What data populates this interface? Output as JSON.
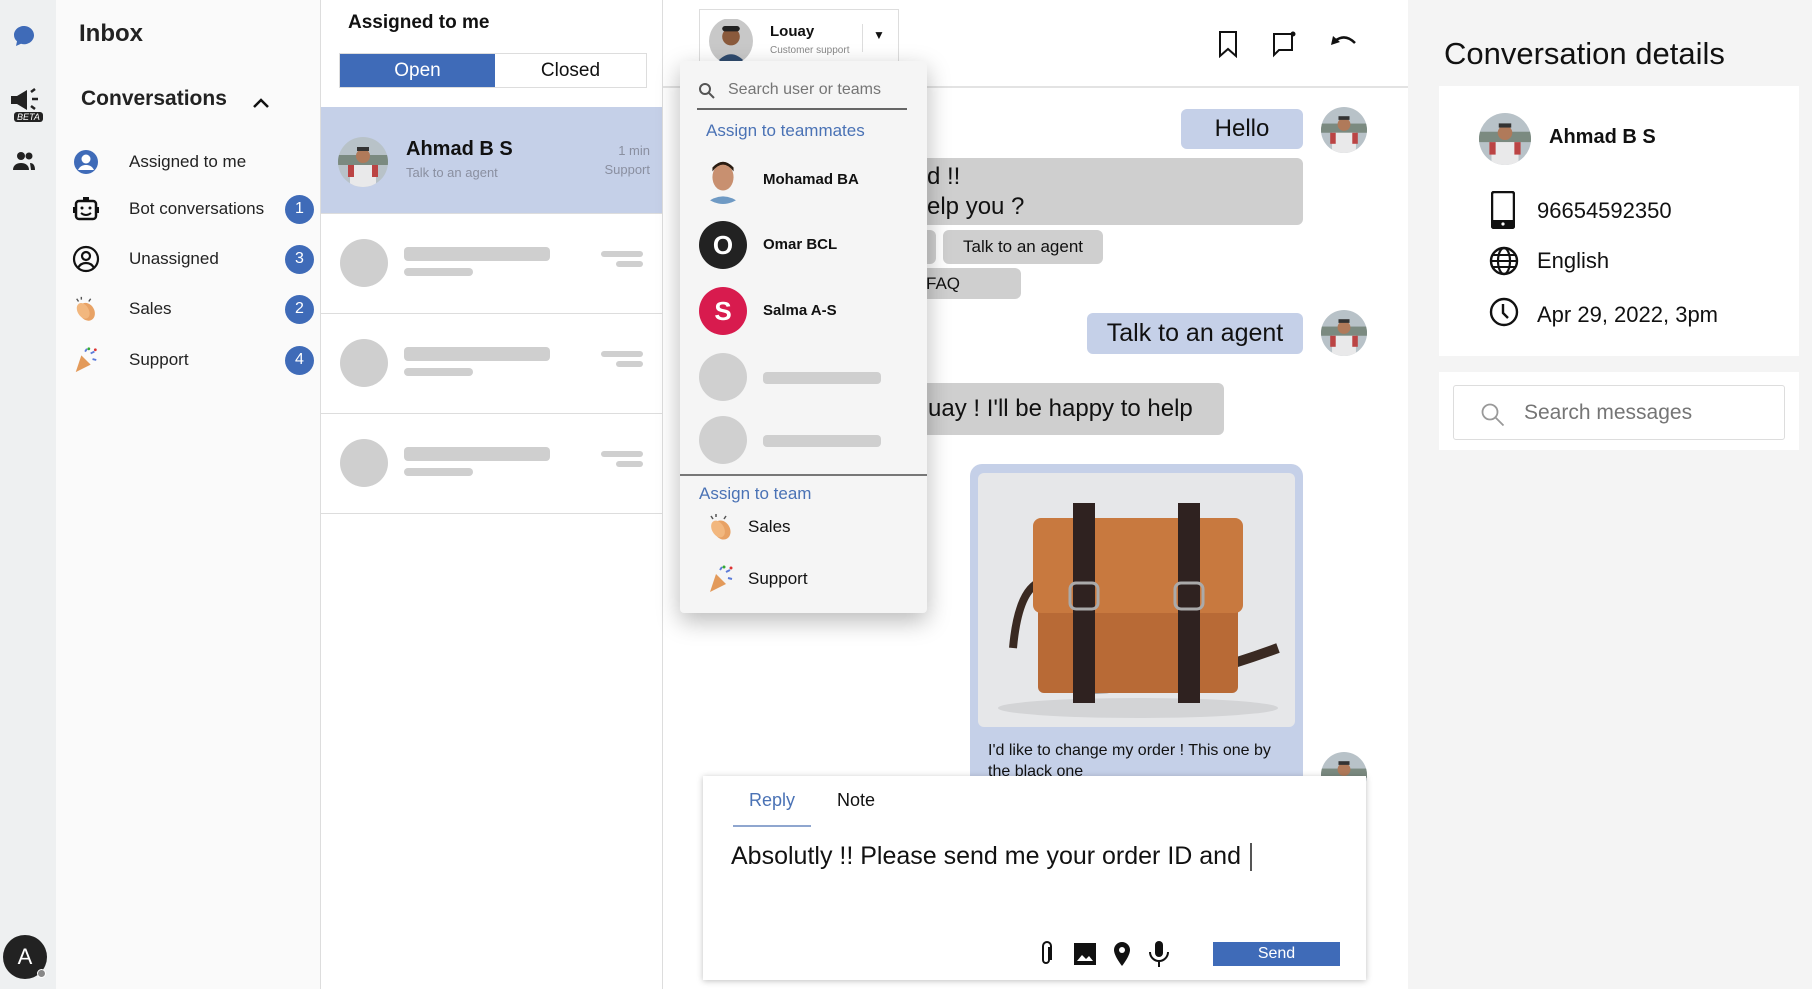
{
  "rail": {
    "icons": [
      "chat-bubble-icon",
      "megaphone-icon",
      "people-icon"
    ],
    "beta_label": "BETA",
    "user_avatar_letter": "A",
    "accent": "#3f6bb8"
  },
  "nav": {
    "title": "Inbox",
    "section": "Conversations",
    "items": [
      {
        "label": "Assigned to me",
        "icon": "user-circle-icon",
        "badge": null
      },
      {
        "label": "Bot conversations",
        "icon": "bot-icon",
        "badge": "1"
      },
      {
        "label": "Unassigned",
        "icon": "user-outline-icon",
        "badge": "3"
      },
      {
        "label": "Sales",
        "icon": "clapping-hands-icon",
        "badge": "2"
      },
      {
        "label": "Support",
        "icon": "party-popper-icon",
        "badge": "4"
      }
    ]
  },
  "list": {
    "title": "Assigned to me",
    "tabs": {
      "open": "Open",
      "closed": "Closed"
    },
    "active_tab": "Open",
    "conversation": {
      "name": "Ahmad B S",
      "preview": "Talk to an agent",
      "time": "1 min",
      "team": "Support"
    }
  },
  "header": {
    "agent_name": "Louay",
    "agent_role": "Customer support",
    "icons": [
      "bookmark-icon",
      "flag-chat-icon",
      "undo-icon"
    ]
  },
  "dropdown": {
    "search_placeholder": "Search user or teams",
    "teammates_heading": "Assign to teammates",
    "teammates": [
      {
        "name": "Mohamad BA",
        "initial": ""
      },
      {
        "name": "Omar BCL",
        "initial": "O",
        "color": "#222222"
      },
      {
        "name": "Salma A-S",
        "initial": "S",
        "color": "#d81b4e"
      }
    ],
    "team_heading": "Assign to team",
    "teams": [
      {
        "label": "Sales",
        "icon": "clapping-hands-icon"
      },
      {
        "label": "Support",
        "icon": "party-popper-icon"
      }
    ]
  },
  "messages": {
    "m1": "Hello",
    "m2_line1": "d !!",
    "m2_line2": "elp you ?",
    "chip1": "Talk to an agent",
    "chip2": "FAQ",
    "m3": "Talk to an agent",
    "m4": "uay ! I'll be happy to help",
    "m5_caption": "I'd like to change my order ! This one by the black one"
  },
  "composer": {
    "tabs": {
      "reply": "Reply",
      "note": "Note"
    },
    "active_tab": "Reply",
    "text": "Absolutly !! Please send me your order ID and ",
    "send": "Send",
    "icons": [
      "attachment-icon",
      "image-icon",
      "location-icon",
      "microphone-icon"
    ]
  },
  "details": {
    "title": "Conversation details",
    "name": "Ahmad B S",
    "phone": "96654592350",
    "language": "English",
    "date": "Apr 29, 2022, 3pm",
    "search_placeholder": "Search messages"
  }
}
